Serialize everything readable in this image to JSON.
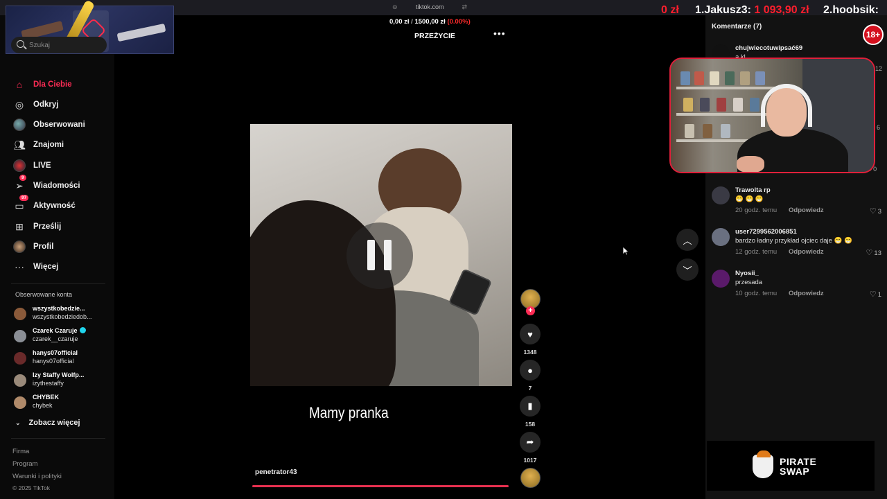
{
  "browser": {
    "url": "tiktok.com"
  },
  "overlay": {
    "rank_clip": "0 zł",
    "rank1_name": "1.Jakusz3:",
    "rank1_value": "1 093,90 zł",
    "rank2": "2.hoobsik:",
    "price_current": "0,00 zł",
    "price_sep": "/",
    "price_goal": "1500,00 zł",
    "price_percent": "(0.00%)",
    "event_title": "PRZEŻYCIE",
    "age_badge": "18+",
    "ad_line1": "PIRATE",
    "ad_line2": "SWAP"
  },
  "sidebar": {
    "search_placeholder": "Szukaj",
    "nav": [
      {
        "label": "Dla Ciebie",
        "icon": "home-icon"
      },
      {
        "label": "Odkryj",
        "icon": "compass-icon"
      },
      {
        "label": "Obserwowani",
        "icon": "following-avatar-icon"
      },
      {
        "label": "Znajomi",
        "icon": "friends-icon"
      },
      {
        "label": "LIVE",
        "icon": "live-icon"
      },
      {
        "label": "Wiadomości",
        "icon": "messages-icon",
        "badge": "9"
      },
      {
        "label": "Aktywność",
        "icon": "activity-icon",
        "badge": "97"
      },
      {
        "label": "Prześlij",
        "icon": "upload-icon"
      },
      {
        "label": "Profil",
        "icon": "profile-avatar-icon"
      },
      {
        "label": "Więcej",
        "icon": "more-icon"
      }
    ],
    "followed_header": "Obserwowane konta",
    "accounts": [
      {
        "name": "wszystkobedzie...",
        "handle": "wszystkobedziedob...",
        "color": "#8a5a3a"
      },
      {
        "name": "Czarek Czaruje",
        "handle": "czarek__czaruje",
        "color": "#8b8f96",
        "verified": true
      },
      {
        "name": "hanys07official",
        "handle": "hanys07official",
        "color": "#6a2a2a"
      },
      {
        "name": "Izy Staffy Wolfp...",
        "handle": "izythestaffy",
        "color": "#9a8a7a"
      },
      {
        "name": "CHYBEK",
        "handle": "chybek",
        "color": "#b08a6a"
      }
    ],
    "see_more": "Zobacz więcej",
    "footer": [
      "Firma",
      "Program",
      "Warunki i polityki",
      "© 2025 TikTok"
    ]
  },
  "video": {
    "caption": "Mamy pranka",
    "author": "penetrator43",
    "likes": "1348",
    "comments": "7",
    "saves": "158",
    "shares": "1017"
  },
  "comments": {
    "header": "Komentarze (7)",
    "partial_user": "chujwiecotuwipsać69",
    "partial_text": "a kl...",
    "side_likes": [
      "12",
      "6",
      "0"
    ],
    "reply_label": "Odpowiedz",
    "items": [
      {
        "user": "Trawolta rp",
        "text": "😁 😁 😁",
        "time": "20 godz. temu",
        "likes": "3",
        "color": "#3a3a44"
      },
      {
        "user": "user7299562006851",
        "text": "bardzo ładny przykład ojciec daje 😁 😁",
        "time": "12 godz. temu",
        "likes": "13",
        "color": "#6a7080"
      },
      {
        "user": "Nyosii_",
        "text": "przesada",
        "time": "10 godz. temu",
        "likes": "1",
        "color": "#5a1a6a"
      }
    ]
  }
}
